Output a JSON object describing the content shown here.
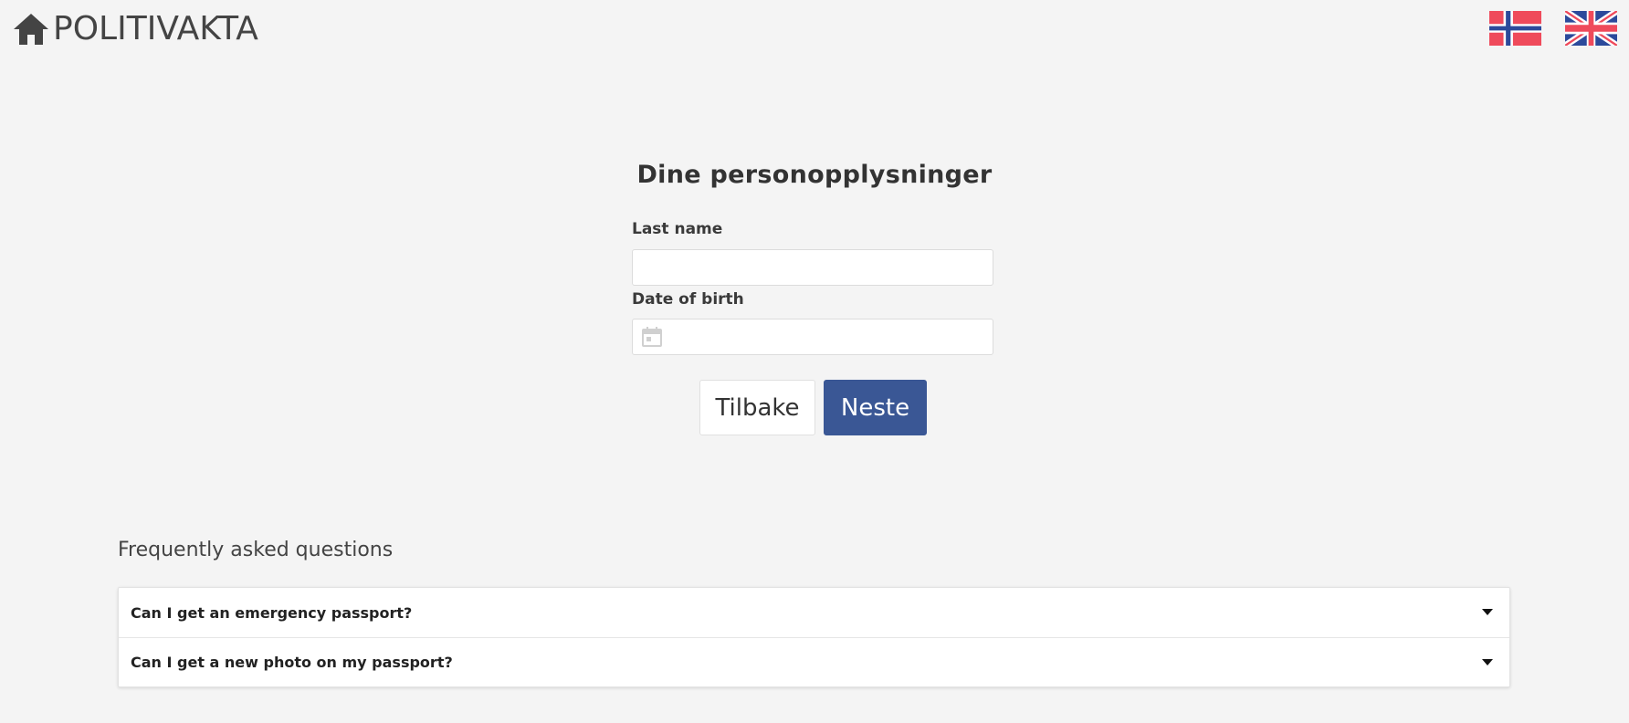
{
  "header": {
    "brand": "POLITIVAKTA",
    "home_icon": "home-icon",
    "languages": [
      {
        "code": "no",
        "icon": "norway-flag-icon"
      },
      {
        "code": "en",
        "icon": "uk-flag-icon"
      }
    ]
  },
  "form": {
    "title": "Dine personopplysninger",
    "last_name_label": "Last name",
    "last_name_value": "",
    "dob_label": "Date of birth",
    "dob_value": "",
    "calendar_icon": "calendar-icon",
    "back_label": "Tilbake",
    "next_label": "Neste"
  },
  "faq": {
    "title": "Frequently asked questions",
    "items": [
      {
        "question": "Can I get an emergency passport?"
      },
      {
        "question": "Can I get a new photo on my passport?"
      }
    ]
  },
  "colors": {
    "background": "#f4f4f4",
    "primary": "#3a5795",
    "text": "#333333"
  }
}
